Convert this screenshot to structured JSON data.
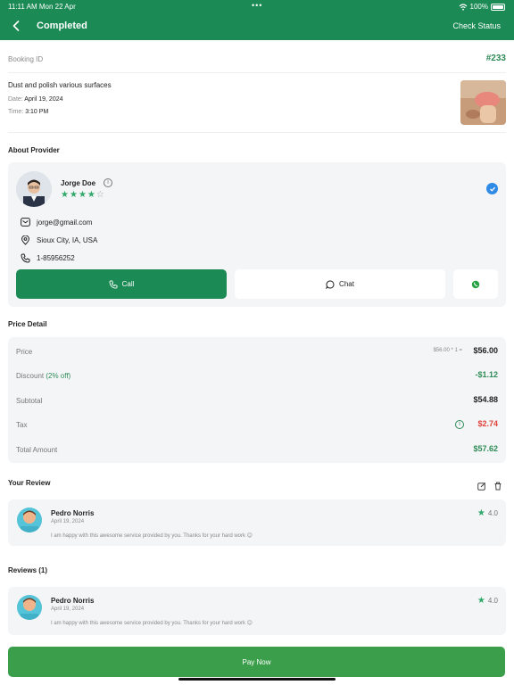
{
  "status_bar": {
    "time": "11:11 AM  Mon 22 Apr",
    "dots": "•••",
    "battery": "100%"
  },
  "header": {
    "title": "Completed",
    "action": "Check Status"
  },
  "booking": {
    "id_label": "Booking ID",
    "id_value": "#233",
    "service": "Dust and polish various surfaces",
    "date_label": "Date:",
    "date_value": "April 19, 2024",
    "time_label": "Time:",
    "time_value": "3:10 PM"
  },
  "provider": {
    "section_title": "About Provider",
    "name": "Jorge Doe",
    "rating": 4,
    "rating_max": 5,
    "email": "jorge@gmail.com",
    "location": "Sioux City, IA, USA",
    "phone": "1-85956252",
    "call_label": "Call",
    "chat_label": "Chat"
  },
  "price": {
    "section_title": "Price Detail",
    "price_label": "Price",
    "price_calc": "$56.00 * 1  =",
    "price_value": "$56.00",
    "discount_label": "Discount",
    "discount_pct": "(2% off)",
    "discount_value": "-$1.12",
    "subtotal_label": "Subtotal",
    "subtotal_value": "$54.88",
    "tax_label": "Tax",
    "tax_value": "$2.74",
    "total_label": "Total Amount",
    "total_value": "$57.62"
  },
  "your_review": {
    "section_title": "Your Review",
    "name": "Pedro Norris",
    "date": "April 19, 2024",
    "rating": "4.0",
    "text": "I am happy with this awesome service provided by you. Thanks for your hard work 😊"
  },
  "reviews": {
    "section_title": "Reviews (1)",
    "items": [
      {
        "name": "Pedro Norris",
        "date": "April 19, 2024",
        "rating": "4.0",
        "text": "I am happy with this awesome service provided by you. Thanks for your hard work 😊"
      }
    ]
  },
  "footer": {
    "pay_label": "Pay Now"
  },
  "colors": {
    "primary": "#1b8a55",
    "green_text": "#2e8b57",
    "red_text": "#e0413a",
    "card_bg": "#f4f5f6"
  }
}
